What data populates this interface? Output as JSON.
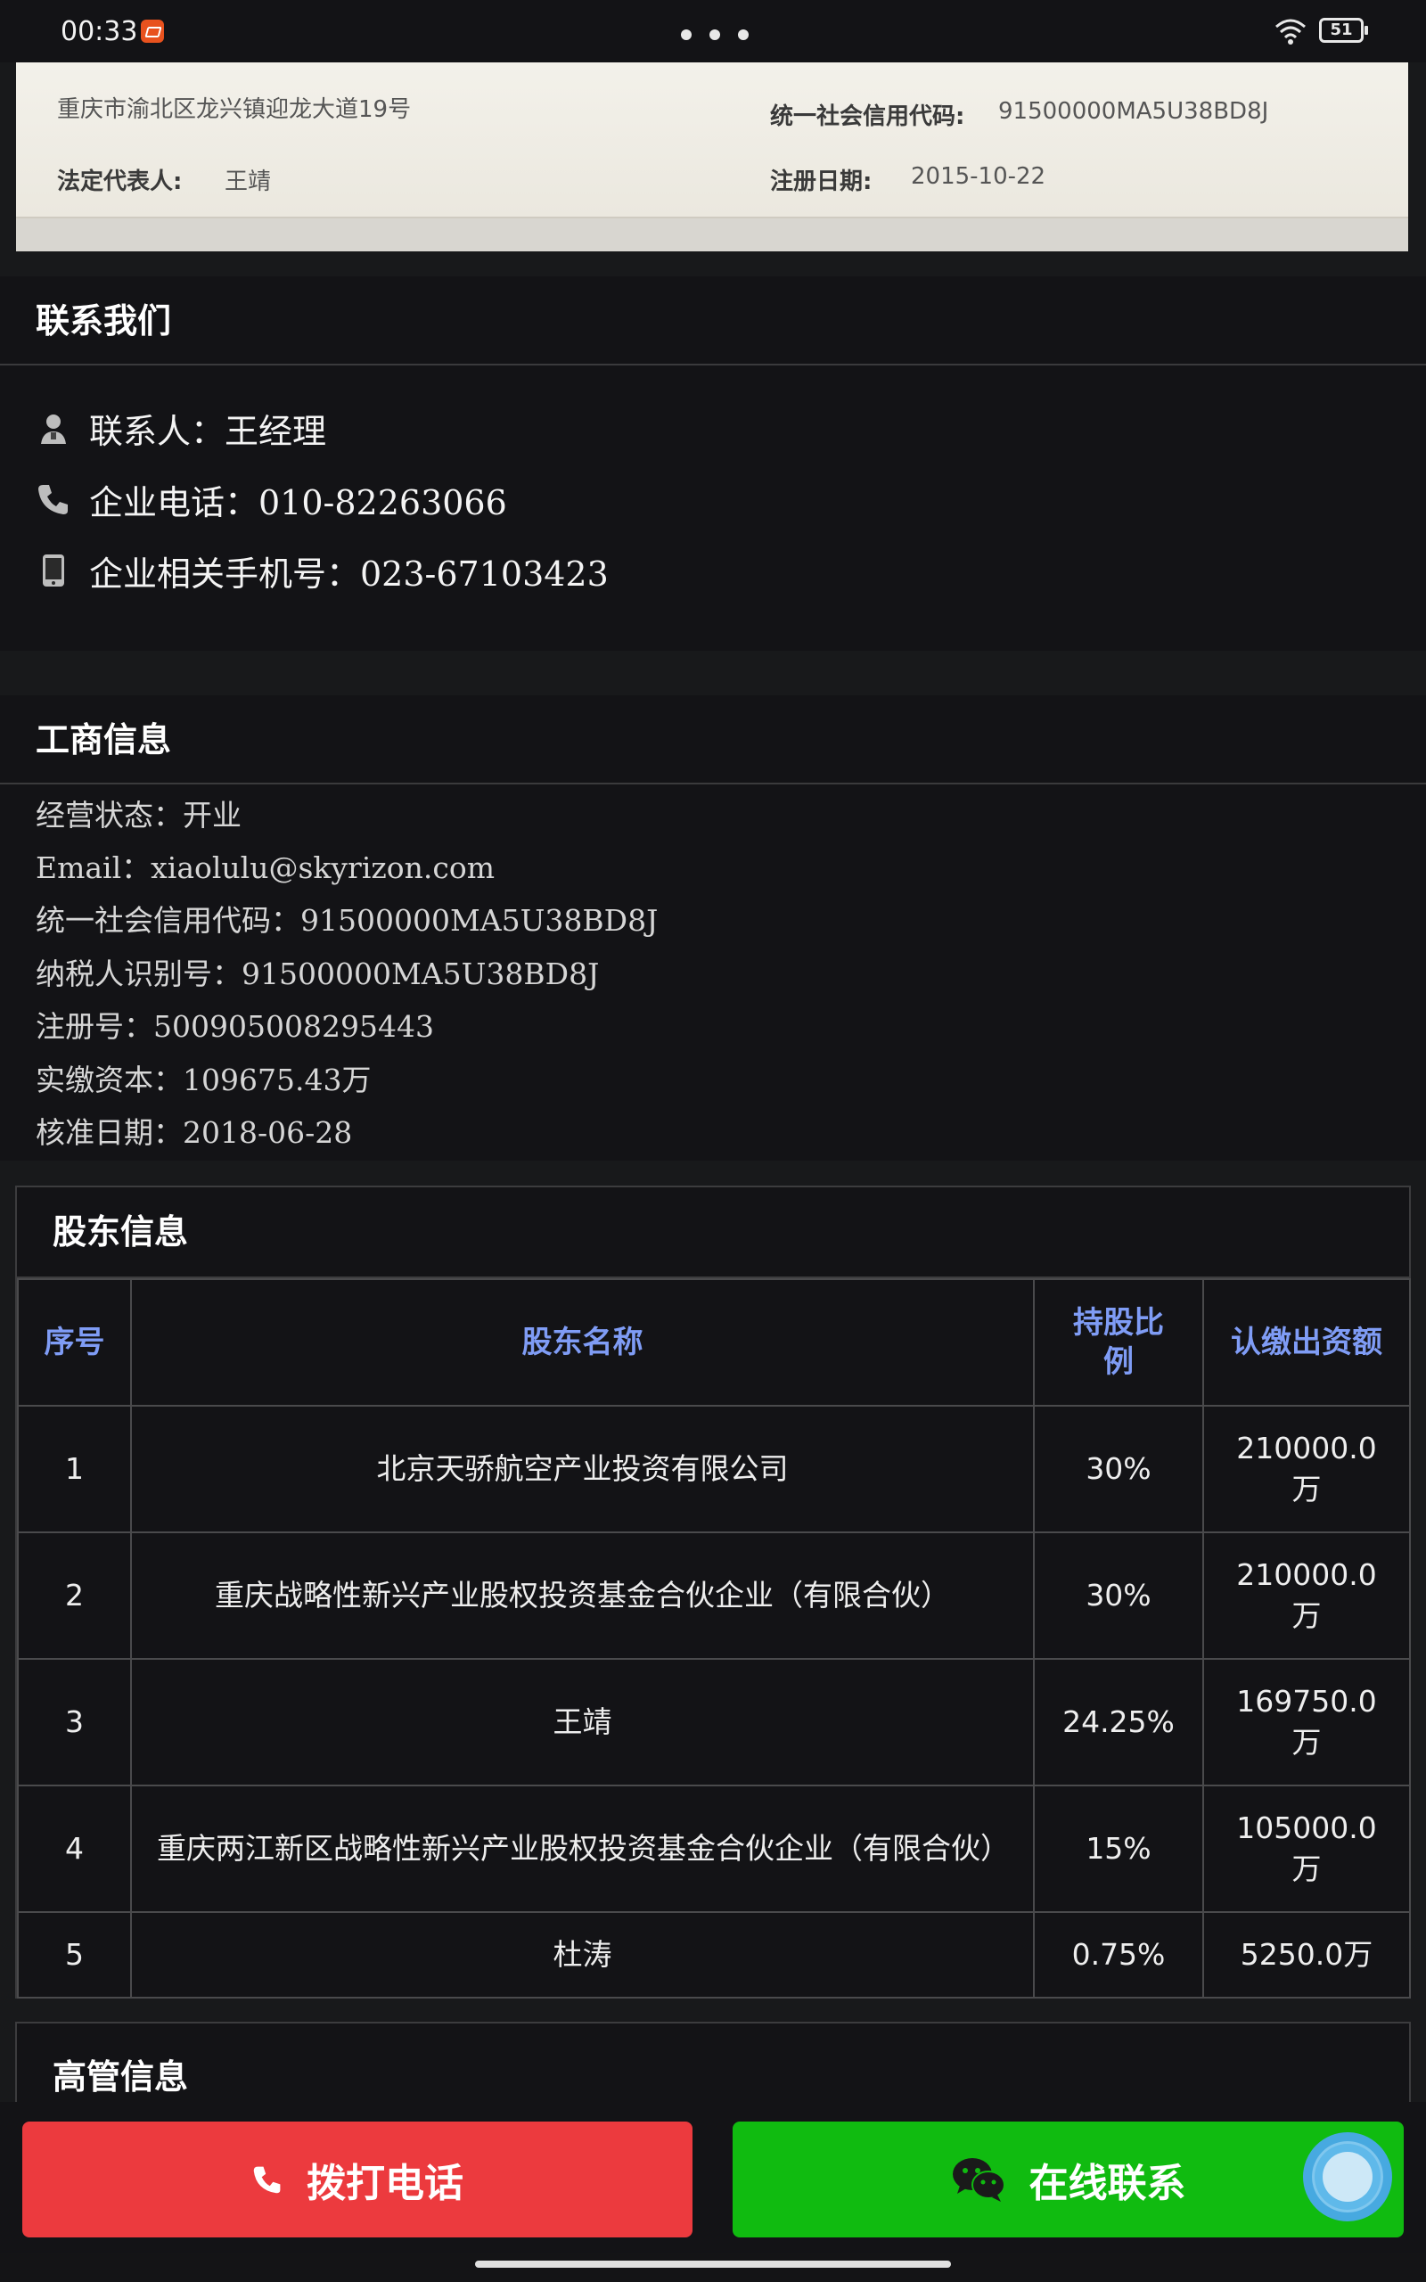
{
  "status_bar": {
    "time": "00:33",
    "battery": "51"
  },
  "license": {
    "address": "重庆市渝北区龙兴镇迎龙大道19号",
    "credit_code_label": "统一社会信用代码:",
    "credit_code_value": "91500000MA5U38BD8J",
    "legal_rep_label": "法定代表人:",
    "legal_rep_value": "王靖",
    "reg_date_label": "注册日期:",
    "reg_date_value": "2015-10-22"
  },
  "contact": {
    "title": "联系我们",
    "person": "联系人：王经理",
    "phone": "企业电话：010-82263066",
    "mobile": "企业相关手机号：023-67103423"
  },
  "business_info": {
    "title": "工商信息",
    "lines": [
      "经营状态：开业",
      "Email：xiaolulu@skyrizon.com",
      "统一社会信用代码：91500000MA5U38BD8J",
      "纳税人识别号：91500000MA5U38BD8J",
      "注册号：500905008295443",
      "实缴资本：109675.43万",
      "核准日期：2018-06-28"
    ]
  },
  "shareholders": {
    "title": "股东信息",
    "headers": [
      "序号",
      "股东名称",
      "持股比例",
      "认缴出资额"
    ],
    "rows": [
      {
        "no": "1",
        "name": "北京天骄航空产业投资有限公司",
        "ratio": "30%",
        "amount": "210000.0万"
      },
      {
        "no": "2",
        "name": "重庆战略性新兴产业股权投资基金合伙企业（有限合伙）",
        "ratio": "30%",
        "amount": "210000.0万"
      },
      {
        "no": "3",
        "name": "王靖",
        "ratio": "24.25%",
        "amount": "169750.0万"
      },
      {
        "no": "4",
        "name": "重庆两江新区战略性新兴产业股权投资基金合伙企业（有限合伙）",
        "ratio": "15%",
        "amount": "105000.0万"
      },
      {
        "no": "5",
        "name": "杜涛",
        "ratio": "0.75%",
        "amount": "5250.0万"
      }
    ]
  },
  "executives": {
    "title": "高管信息"
  },
  "actions": {
    "call_label": "拨打电话",
    "chat_label": "在线联系"
  },
  "colors": {
    "call_button": "#ec3a3e",
    "chat_button": "#10bb10",
    "table_header_text": "#7f9cf5",
    "float_button": "#5fb9ea"
  }
}
